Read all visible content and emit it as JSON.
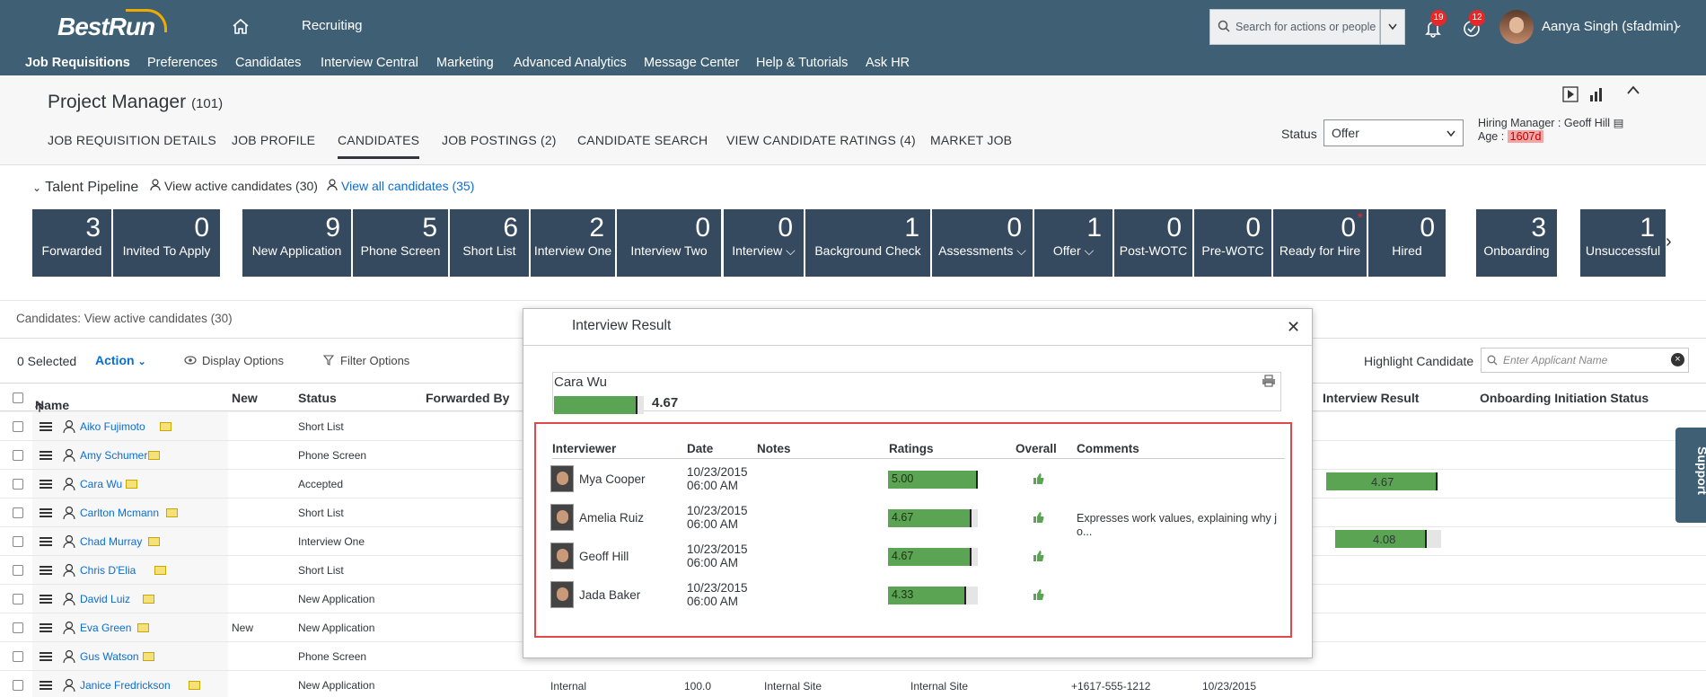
{
  "header": {
    "brand": "BestRun",
    "module": "Recruiting",
    "search_placeholder": "Search for actions or people",
    "notifications_count": "19",
    "todo_count": "12",
    "user_name": "Aanya Singh (sfadmin)"
  },
  "nav": [
    "Job Requisitions",
    "Preferences",
    "Candidates",
    "Interview Central",
    "Marketing",
    "Advanced Analytics",
    "Message Center",
    "Help & Tutorials",
    "Ask HR"
  ],
  "requisition": {
    "title": "Project Manager",
    "id": "(101)",
    "tabs": [
      "JOB REQUISITION DETAILS",
      "JOB PROFILE",
      "CANDIDATES",
      "JOB POSTINGS (2)",
      "CANDIDATE SEARCH",
      "VIEW CANDIDATE RATINGS (4)",
      "MARKET JOB"
    ],
    "status_label": "Status",
    "status_value": "Offer",
    "hiring_manager_label": "Hiring Manager :",
    "hiring_manager": "Geoff Hill",
    "age_label": "Age :",
    "age_value": "1607d"
  },
  "pipeline": {
    "title": "Talent Pipeline",
    "view_active": "View active candidates (30)",
    "view_all": "View all candidates (35)",
    "stages": [
      {
        "count": "3",
        "label": "Forwarded"
      },
      {
        "count": "0",
        "label": "Invited To Apply"
      },
      {
        "count": "9",
        "label": "New Application"
      },
      {
        "count": "5",
        "label": "Phone Screen"
      },
      {
        "count": "6",
        "label": "Short List"
      },
      {
        "count": "2",
        "label": "Interview One"
      },
      {
        "count": "0",
        "label": "Interview Two"
      },
      {
        "count": "0",
        "label": "Interview ⌵"
      },
      {
        "count": "1",
        "label": "Background Check"
      },
      {
        "count": "0",
        "label": "Assessments ⌵"
      },
      {
        "count": "1",
        "label": "Offer ⌵"
      },
      {
        "count": "0",
        "label": "Post-WOTC"
      },
      {
        "count": "0",
        "label": "Pre-WOTC"
      },
      {
        "count": "0",
        "label": "Ready for Hire"
      },
      {
        "count": "0",
        "label": "Hired"
      },
      {
        "count": "3",
        "label": "Onboarding"
      },
      {
        "count": "1",
        "label": "Unsuccessful"
      }
    ]
  },
  "list": {
    "caption": "Candidates: View active candidates (30)",
    "selected": "0 Selected",
    "action": "Action",
    "display_options": "Display Options",
    "filter_options": "Filter Options",
    "highlight_label": "Highlight Candidate",
    "highlight_placeholder": "Enter Applicant Name",
    "columns": {
      "name": "Name",
      "new": "New",
      "status": "Status",
      "forwarded_by": "Forwarded By",
      "interview_result": "Interview Result",
      "onboarding": "Onboarding Initiation Status"
    },
    "rows": [
      {
        "name": "Aiko Fujimoto",
        "new": "",
        "status": "Short List"
      },
      {
        "name": "Amy Schumer",
        "new": "",
        "status": "Phone Screen"
      },
      {
        "name": "Cara Wu",
        "new": "",
        "status": "Accepted"
      },
      {
        "name": "Carlton Mcmann",
        "new": "",
        "status": "Short List"
      },
      {
        "name": "Chad Murray",
        "new": "",
        "status": "Interview One"
      },
      {
        "name": "Chris D'Elia",
        "new": "",
        "status": "Short List"
      },
      {
        "name": "David Luiz",
        "new": "",
        "status": "New Application"
      },
      {
        "name": "Eva Green",
        "new": "New",
        "status": "New Application"
      },
      {
        "name": "Gus Watson",
        "new": "",
        "status": "Phone Screen"
      },
      {
        "name": "Janice Fredrickson",
        "new": "",
        "status": "New Application"
      }
    ],
    "interview_results": {
      "cara": "4.67",
      "chad": "4.08"
    },
    "last_row": {
      "source": "Internal",
      "score": "100.0",
      "site1": "Internal Site",
      "site2": "Internal Site",
      "phone": "+1617-555-1212",
      "date": "10/23/2015"
    }
  },
  "modal": {
    "title": "Interview Result",
    "candidate": "Cara Wu",
    "score": "4.67",
    "score_fraction": 0.934,
    "headers": {
      "interviewer": "Interviewer",
      "date": "Date",
      "notes": "Notes",
      "ratings": "Ratings",
      "overall": "Overall",
      "comments": "Comments"
    },
    "rows": [
      {
        "name": "Mya Cooper",
        "date": "10/23/2015",
        "time": "06:00 AM",
        "rating": "5.00",
        "fraction": 1.0,
        "comment": ""
      },
      {
        "name": "Amelia Ruiz",
        "date": "10/23/2015",
        "time": "06:00 AM",
        "rating": "4.67",
        "fraction": 0.934,
        "comment": "Expresses work values, explaining why jo..."
      },
      {
        "name": "Geoff Hill",
        "date": "10/23/2015",
        "time": "06:00 AM",
        "rating": "4.67",
        "fraction": 0.934,
        "comment": ""
      },
      {
        "name": "Jada Baker",
        "date": "10/23/2015",
        "time": "06:00 AM",
        "rating": "4.33",
        "fraction": 0.866,
        "comment": ""
      }
    ]
  },
  "support": "Support",
  "colors": {
    "header": "#3f5f75",
    "tile": "#354a5f",
    "bar": "#5aa454",
    "highlight": "#e0494b"
  }
}
